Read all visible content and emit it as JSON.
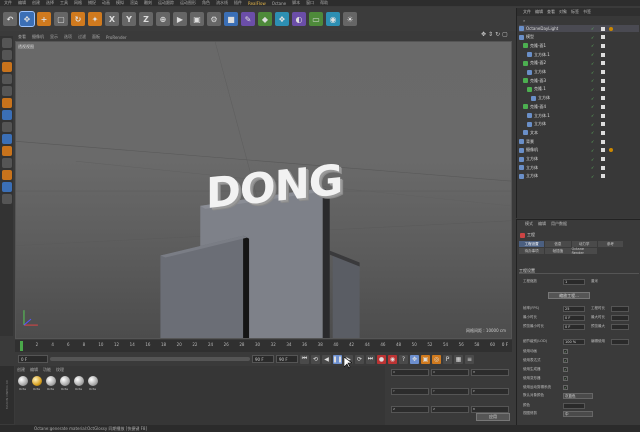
{
  "menubar": {
    "items": [
      "文件",
      "编辑",
      "创建",
      "选择",
      "工具",
      "网格",
      "捕捉",
      "动画",
      "模拟",
      "渲染",
      "雕刻",
      "运动跟踪",
      "运动图形",
      "角色",
      "流水线",
      "插件",
      "RealFlow",
      "Octane",
      "脚本",
      "窗口",
      "帮助"
    ]
  },
  "viewport": {
    "menu": [
      "查看",
      "摄像机",
      "显示",
      "选项",
      "过滤",
      "面板",
      "ProRender"
    ],
    "label": "透视视图",
    "text_3d": "DONG",
    "grid_distance": "网格间距 : 10000 cm"
  },
  "timeline": {
    "ticks": [
      "0",
      "2",
      "4",
      "6",
      "8",
      "10",
      "12",
      "14",
      "16",
      "18",
      "20",
      "22",
      "24",
      "26",
      "28",
      "30",
      "32",
      "34",
      "36",
      "38",
      "40",
      "42",
      "44",
      "46",
      "48",
      "50",
      "52",
      "54",
      "56",
      "58",
      "60"
    ],
    "end_frame": "0 F",
    "current_start": "0 F",
    "current_field": "0 F",
    "end_field_a": "90 F",
    "end_field_b": "90 F"
  },
  "materials": {
    "menu": [
      "创建",
      "编辑",
      "功能",
      "纹理"
    ],
    "items": [
      {
        "name": "Octa",
        "color": "silver"
      },
      {
        "name": "Octa",
        "color": "gold"
      },
      {
        "name": "Octa",
        "color": "silver"
      },
      {
        "name": "Octa",
        "color": "silver"
      },
      {
        "name": "Octa",
        "color": "silver"
      },
      {
        "name": "Octa",
        "color": "silver"
      }
    ]
  },
  "coords": {
    "cells": [
      "X",
      "X",
      "H",
      "Y",
      "Y",
      "P",
      "Z",
      "Z",
      "B"
    ],
    "apply": "应用"
  },
  "statusbar": {
    "text": "Octane:generate material:OctGlossy  同期播放 [快捷键 F8]"
  },
  "objects": {
    "header": [
      "文件",
      "编辑",
      "查看",
      "对象",
      "标签",
      "书签"
    ],
    "rows": [
      {
        "name": "OctaneDayLight",
        "type": "light"
      },
      {
        "name": "模型",
        "type": "null"
      },
      {
        "name": "克隆-面1",
        "type": "cloner"
      },
      {
        "name": "立方体.1",
        "type": "cube"
      },
      {
        "name": "克隆-面2",
        "type": "cloner"
      },
      {
        "name": "立方体",
        "type": "cube"
      },
      {
        "name": "克隆-面3",
        "type": "cloner"
      },
      {
        "name": "克隆.1",
        "type": "cloner"
      },
      {
        "name": "立方体",
        "type": "cube"
      },
      {
        "name": "克隆-面4",
        "type": "cloner"
      },
      {
        "name": "立方体.1",
        "type": "cube"
      },
      {
        "name": "立方体",
        "type": "cube"
      },
      {
        "name": "文本",
        "type": "text"
      },
      {
        "name": "背景",
        "type": "bg"
      },
      {
        "name": "摄像机",
        "type": "camera"
      },
      {
        "name": "立方体",
        "type": "cube"
      },
      {
        "name": "立方体",
        "type": "cube"
      },
      {
        "name": "立方体",
        "type": "cube"
      }
    ]
  },
  "attributes": {
    "menu": [
      "模式",
      "编辑",
      "用户数据"
    ],
    "title": "工程",
    "tabs": [
      "工程设置",
      "信息",
      "动力学",
      "参考",
      "待办事项",
      "帧插值",
      "Octane Render"
    ],
    "section": "工程设置",
    "props": [
      {
        "label": "工程缩放",
        "value": "1",
        "right": "厘米"
      },
      {
        "label": "帧率(FPS)",
        "value": "25",
        "right": "工程时长"
      },
      {
        "label": "最小时长",
        "value": "0 F",
        "right": "最大时长"
      },
      {
        "label": "预览最小时长",
        "value": "0 F",
        "right": "预览最大"
      },
      {
        "label": "细节级别(LOD)",
        "value": "100 %",
        "right": "编辑使用"
      },
      {
        "label": "使用动画",
        "value": "✓"
      },
      {
        "label": "使用表达式",
        "value": "✓"
      },
      {
        "label": "使用生成器",
        "value": "✓"
      },
      {
        "label": "使用变形器",
        "value": "✓"
      },
      {
        "label": "使用运动剪辑系统",
        "value": "✓"
      },
      {
        "label": "默认对象颜色",
        "value": "灰蓝色"
      },
      {
        "label": "颜色",
        "value": ""
      },
      {
        "label": "视图修剪",
        "value": "中"
      }
    ],
    "time_button": "缩放工程..."
  }
}
